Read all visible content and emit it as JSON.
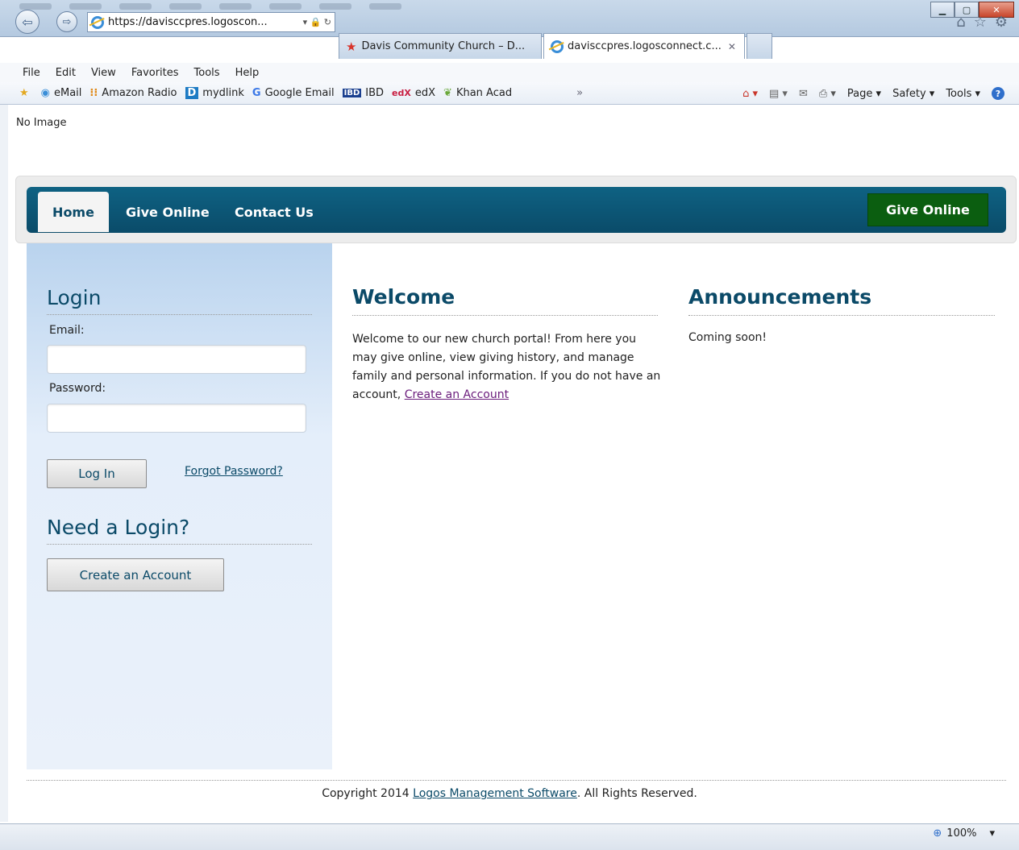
{
  "browser": {
    "address": "https://davisccpres.logoscon...",
    "address_tail": "▾ 🔒 ↻",
    "tabs": [
      {
        "label": "Davis Community Church – D..."
      },
      {
        "label": "davisccpres.logosconnect.c..."
      }
    ],
    "tab_close": "✕",
    "menu": [
      "File",
      "Edit",
      "View",
      "Favorites",
      "Tools",
      "Help"
    ],
    "favorites": [
      {
        "label": "eMail",
        "icon": "ie-globe-icon"
      },
      {
        "label": "Amazon Radio",
        "icon": "amazon-icon"
      },
      {
        "label": "mydlink",
        "icon": "dlink-icon"
      },
      {
        "label": "Google Email",
        "icon": "google-icon"
      },
      {
        "label": "IBD",
        "icon": "ibd-icon"
      },
      {
        "label": "edX",
        "icon": "edx-icon"
      },
      {
        "label": "Khan Acad",
        "icon": "leaf-icon"
      }
    ],
    "right_tools": [
      "Page ▾",
      "Safety ▾",
      "Tools ▾"
    ],
    "zoom": "100%"
  },
  "page": {
    "no_image": "No Image",
    "nav": {
      "tabs": [
        "Home",
        "Give Online",
        "Contact Us"
      ],
      "give_button": "Give Online"
    },
    "login": {
      "title": "Login",
      "email_label": "Email:",
      "password_label": "Password:",
      "login_button": "Log In",
      "forgot_link": "Forgot Password?",
      "need_title": "Need a Login?",
      "create_button": "Create an Account"
    },
    "welcome": {
      "title": "Welcome",
      "text": "Welcome to our new church portal! From here you may give online, view giving history, and manage family and personal information. If you do not have an account,",
      "link": "Create an Account"
    },
    "announcements": {
      "title": "Announcements",
      "text": "Coming soon!"
    },
    "footer": {
      "prefix": "Copyright 2014",
      "link": "Logos Management Software",
      "suffix": ". All Rights Reserved."
    }
  },
  "colors": {
    "navbar": "#0a4b69",
    "give_button": "#0b5e10",
    "heading": "#0b4a68",
    "visited_link": "#6a1b7b"
  }
}
